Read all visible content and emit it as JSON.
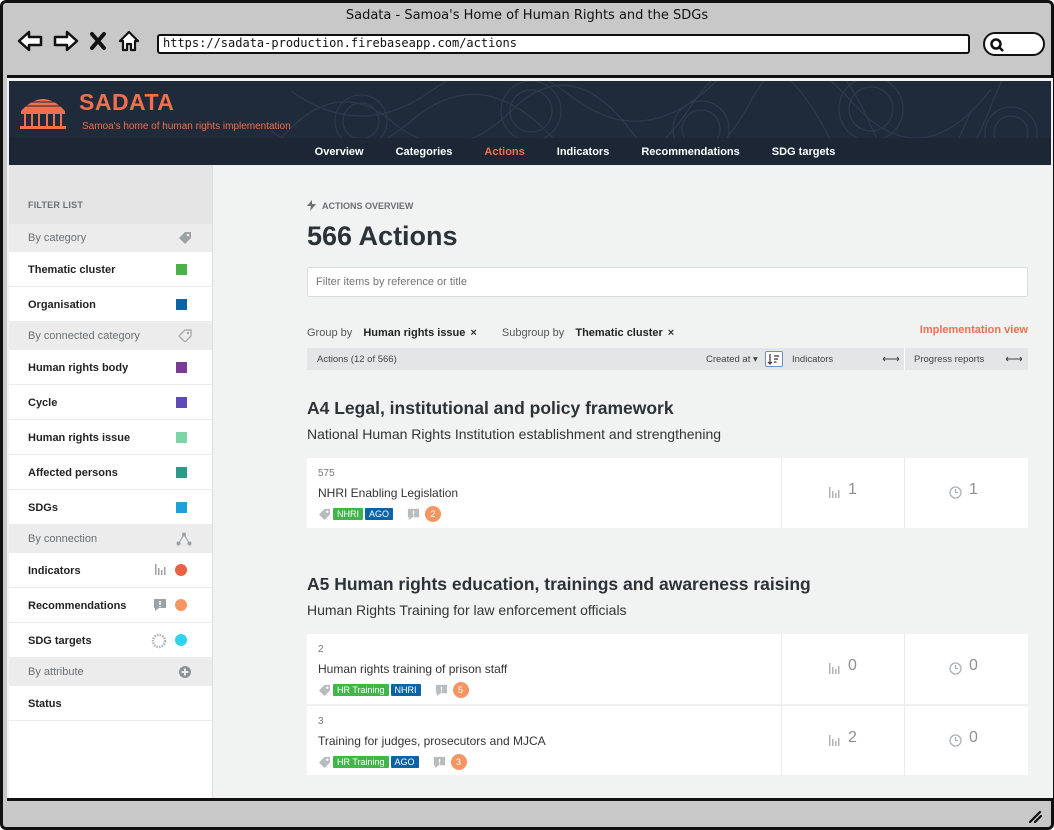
{
  "browser": {
    "window_title": "Sadata - Samoa's Home of Human Rights and the SDGs",
    "url": "https://sadata-production.firebaseapp.com/actions"
  },
  "site": {
    "brand": "SADATA",
    "tagline": "Samoa's home of human rights implementation",
    "accent": "#f06f4d",
    "header_bg": "#1f2a3a"
  },
  "nav": {
    "tabs": [
      {
        "label": "Overview",
        "active": false
      },
      {
        "label": "Categories",
        "active": false
      },
      {
        "label": "Actions",
        "active": true
      },
      {
        "label": "Indicators",
        "active": false
      },
      {
        "label": "Recommendations",
        "active": false
      },
      {
        "label": "SDG targets",
        "active": false
      }
    ]
  },
  "sidebar": {
    "heading": "FILTER LIST",
    "groups": [
      {
        "label": "By category",
        "icon": "tag-icon",
        "items": [
          {
            "label": "Thematic cluster",
            "color": "#4cb04a"
          },
          {
            "label": "Organisation",
            "color": "#0b63a8"
          }
        ]
      },
      {
        "label": "By connected category",
        "icon": "tag-outline-icon",
        "items": [
          {
            "label": "Human rights body",
            "color": "#7b3a96"
          },
          {
            "label": "Cycle",
            "color": "#5e4bb6"
          },
          {
            "label": "Human rights issue",
            "color": "#7dd4a6"
          },
          {
            "label": "Affected persons",
            "color": "#2b9a8a"
          },
          {
            "label": "SDGs",
            "color": "#1ea0db"
          }
        ]
      },
      {
        "label": "By connection",
        "icon": "connection-icon",
        "items": [
          {
            "label": "Indicators",
            "icon": "bar-chart-icon",
            "color": "#e8623f"
          },
          {
            "label": "Recommendations",
            "icon": "comment-icon",
            "color": "#f59562"
          },
          {
            "label": "SDG targets",
            "icon": "sdg-wheel-icon",
            "color": "#2fd2f0"
          }
        ]
      },
      {
        "label": "By attribute",
        "icon": "plus-circle-icon",
        "items": [
          {
            "label": "Status"
          }
        ]
      }
    ]
  },
  "main": {
    "kicker": "ACTIONS OVERVIEW",
    "title": "566 Actions",
    "filter_placeholder": "Filter items by reference or title",
    "group_by_label": "Group by",
    "group_by_value": "Human rights issue",
    "subgroup_by_label": "Subgroup by",
    "subgroup_by_value": "Thematic cluster",
    "remove_glyph": "×",
    "implementation_view": "Implementation view",
    "list_header": {
      "count": "Actions (12 of 566)",
      "sort_label": "Created at",
      "col_indicators": "Indicators",
      "col_progress": "Progress reports"
    },
    "groups": [
      {
        "title": "A4 Legal, institutional and policy framework",
        "subtitle": "National Human Rights Institution establishment and strengthening",
        "rows": [
          {
            "ref": "575",
            "title": "NHRI Enabling Legislation",
            "tags": [
              {
                "label": "NHRI",
                "color": "green"
              },
              {
                "label": "AGO",
                "color": "blue"
              }
            ],
            "recs": "2",
            "indicators": "1",
            "progress": "1"
          }
        ]
      },
      {
        "title": "A5 Human rights education, trainings and awareness raising",
        "subtitle": "Human Rights Training for law enforcement officials",
        "rows": [
          {
            "ref": "2",
            "title": "Human rights training of prison staff",
            "tags": [
              {
                "label": "HR Training",
                "color": "green"
              },
              {
                "label": "NHRI",
                "color": "blue"
              }
            ],
            "recs": "5",
            "indicators": "0",
            "progress": "0"
          },
          {
            "ref": "3",
            "title": "Training for judges, prosecutors and MJCA",
            "tags": [
              {
                "label": "HR Training",
                "color": "green"
              },
              {
                "label": "AGO",
                "color": "blue"
              }
            ],
            "recs": "3",
            "indicators": "2",
            "progress": "0"
          }
        ]
      }
    ]
  }
}
